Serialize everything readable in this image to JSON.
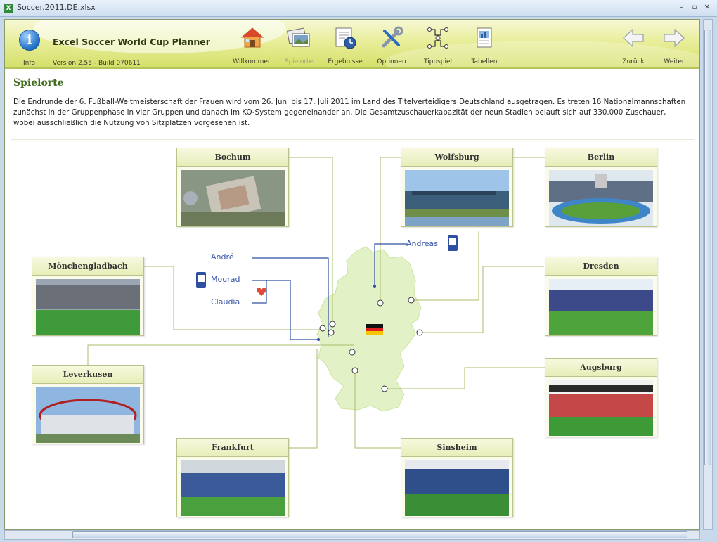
{
  "window": {
    "title": "Soccer.2011.DE.xlsx",
    "min": "–",
    "restore": "▫",
    "close": "✕"
  },
  "ribbon": {
    "info_label": "Info",
    "app_title": "Excel Soccer World Cup Planner",
    "version": "Version 2.55 - Build 070611",
    "nav": [
      {
        "label": "Willkommen",
        "icon": "home-icon"
      },
      {
        "label": "Spielorte",
        "icon": "photos-icon",
        "active": true
      },
      {
        "label": "Ergebnisse",
        "icon": "results-icon"
      },
      {
        "label": "Optionen",
        "icon": "tools-icon"
      },
      {
        "label": "Tippspiel",
        "icon": "bracket-icon"
      },
      {
        "label": "Tabellen",
        "icon": "table-icon"
      }
    ],
    "back_label": "Zurück",
    "next_label": "Weiter"
  },
  "page": {
    "title": "Spielorte",
    "intro": "Die Endrunde der 6. Fußball-Weltmeisterschaft der Frauen wird vom 26. Juni bis 17. Juli 2011 im Land des Titelverteidigers Deutschland ausgetragen. Es treten 16 Nationalmannschaften zunächst in der Gruppenphase in vier Gruppen und danach im KO-System gegeneinander an. Die Gesamtzuschauerkapazität der neun Stadien belauft sich auf 330.000 Zuschauer, wobei ausschließlich die Nutzung von Sitzplätzen vorgesehen ist."
  },
  "venues": [
    {
      "name": "Bochum",
      "photo": "aerial"
    },
    {
      "name": "Wolfsburg",
      "photo": "exterior"
    },
    {
      "name": "Berlin",
      "photo": "bowl"
    },
    {
      "name": "Mönchengladbach",
      "photo": "stands"
    },
    {
      "name": "Dresden",
      "photo": "lit"
    },
    {
      "name": "Leverkusen",
      "photo": "arena"
    },
    {
      "name": "Augsburg",
      "photo": "red"
    },
    {
      "name": "Frankfurt",
      "photo": "stands"
    },
    {
      "name": "Sinsheim",
      "photo": "stands"
    }
  ],
  "people": {
    "andre": "André",
    "mourad": "Mourad",
    "claudia": "Claudia",
    "andreas": "Andreas"
  },
  "colors": {
    "accent": "#3f6b1a",
    "map_fill": "#e3f1c6",
    "link_line": "#a9bd6a",
    "person_line": "#2f4fa0"
  }
}
